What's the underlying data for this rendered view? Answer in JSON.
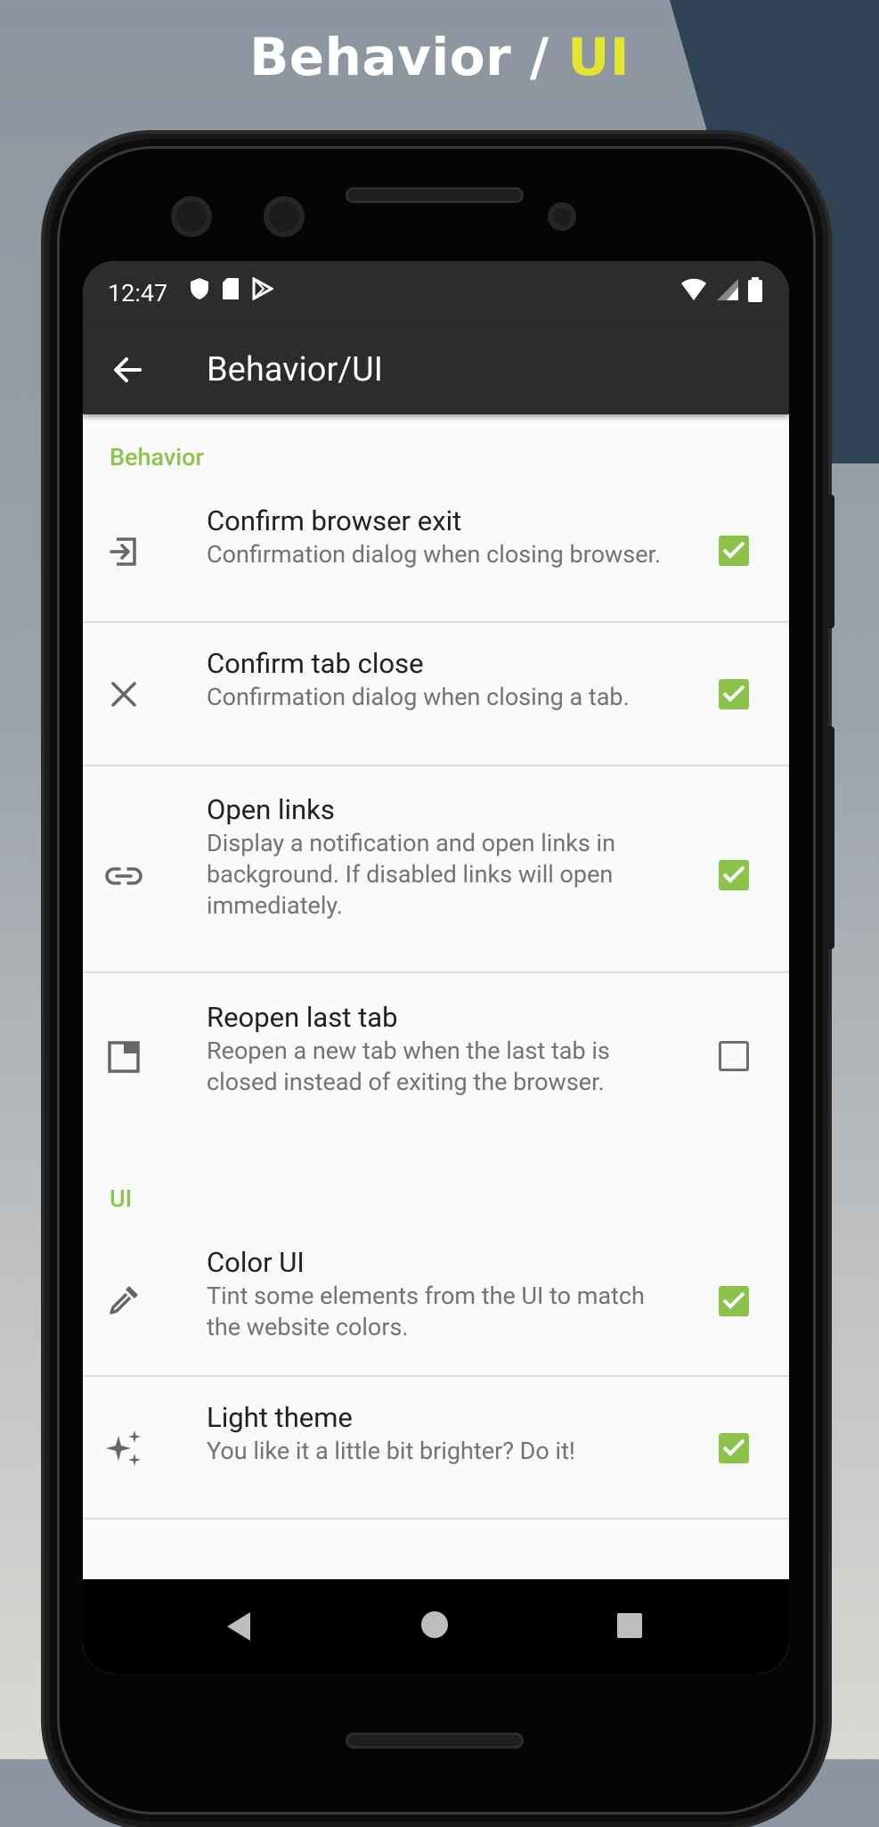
{
  "banner": {
    "prefix": "Behavior / ",
    "accent": "UI"
  },
  "status": {
    "time": "12:47"
  },
  "appbar": {
    "title": "Behavior/UI"
  },
  "sections": {
    "behavior": "Behavior",
    "ui": "UI"
  },
  "prefs": {
    "confirm_exit": {
      "title": "Confirm browser exit",
      "summary": "Confirmation dialog when closing browser.",
      "checked": true,
      "icon": "exit-icon"
    },
    "confirm_tab": {
      "title": "Confirm tab close",
      "summary": "Confirmation dialog when closing a tab.",
      "checked": true,
      "icon": "close-icon"
    },
    "open_links": {
      "title": "Open links",
      "summary": "Display a notification and open links in background. If disabled links will open immediately.",
      "checked": true,
      "icon": "link-icon"
    },
    "reopen_tab": {
      "title": "Reopen last tab",
      "summary": "Reopen a new tab when the last tab is closed instead of exiting the browser.",
      "checked": false,
      "icon": "tab-icon"
    },
    "color_ui": {
      "title": "Color UI",
      "summary": "Tint some elements from the UI to match the website colors.",
      "checked": true,
      "icon": "eyedropper-icon"
    },
    "light_theme": {
      "title": "Light theme",
      "summary": "You like it a little bit brighter? Do it!",
      "checked": true,
      "icon": "sparkle-icon"
    }
  },
  "colors": {
    "accent": "#8bc34a",
    "toolbar": "#2c2c2c",
    "banner_accent": "#e3e532"
  }
}
